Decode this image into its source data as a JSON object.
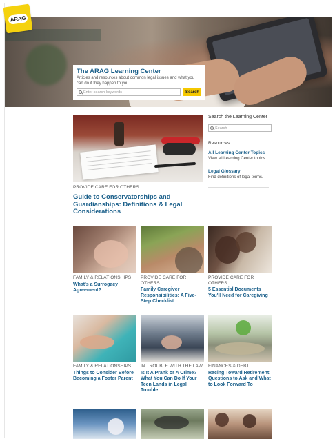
{
  "logo": {
    "text": "ARAG"
  },
  "hero": {
    "title": "The ARAG Learning Center",
    "subtitle": "Articles and resources about common legal issues and what you can do if they happen to you.",
    "search_placeholder": "Enter search keywords",
    "search_button": "Search"
  },
  "featured": {
    "category": "PROVIDE CARE FOR OTHERS",
    "title": "Guide to Conservatorships and Guardianships: Definitions & Legal Considerations"
  },
  "sidebar": {
    "heading": "Search the Learning Center",
    "search_placeholder": "Search",
    "resources_heading": "Resources",
    "links": [
      {
        "label": "All Learning Center Topics",
        "description": "View all Learning Center topics."
      },
      {
        "label": "Legal Glossary",
        "description": "Find definitions of legal terms."
      }
    ]
  },
  "cards": [
    {
      "category": "FAMILY & RELATIONSHIPS",
      "title": "What's a Surrogacy Agreement?"
    },
    {
      "category": "PROVIDE CARE FOR OTHERS",
      "title": "Family Caregiver Responsibilities: A Five-Step Checklist"
    },
    {
      "category": "PROVIDE CARE FOR OTHERS",
      "title": "5 Essential Documents You'll Need for Caregiving"
    },
    {
      "category": "FAMILY & RELATIONSHIPS",
      "title": "Things to Consider Before Becoming a Foster Parent"
    },
    {
      "category": "IN TROUBLE WITH THE LAW",
      "title": "Is It A Prank or A Crime? What You Can Do If Your Teen Lands in Legal Trouble"
    },
    {
      "category": "FINANCES & DEBT",
      "title": "Racing Toward Retirement: Questions to Ask and What to Look Forward To"
    }
  ]
}
